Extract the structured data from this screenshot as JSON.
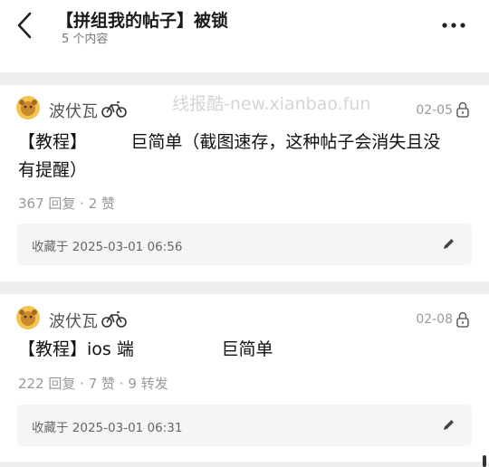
{
  "header": {
    "title": "【拼组我的帖子】被锁",
    "subtitle": "5 个内容",
    "back_icon": "chevron-left-icon",
    "more_icon": "more-horizontal-icon"
  },
  "watermark": "线报酷-new.xianbao.fun",
  "posts": [
    {
      "username": "波伏瓦",
      "date": "02-05",
      "title_line1": "【教程】        巨简单（截图速存，这种帖子会消失且没",
      "title_line2": "有提醒）",
      "stats": "367 回复 · 2 赞",
      "favorited": "收藏于 2025-03-01 06:56"
    },
    {
      "username": "波伏瓦",
      "date": "02-08",
      "title_line1": "【教程】ios 端                巨简单",
      "title_line2": "",
      "stats": "222 回复 · 7 赞 · 9 转发",
      "favorited": "收藏于 2025-03-01 06:31"
    }
  ]
}
